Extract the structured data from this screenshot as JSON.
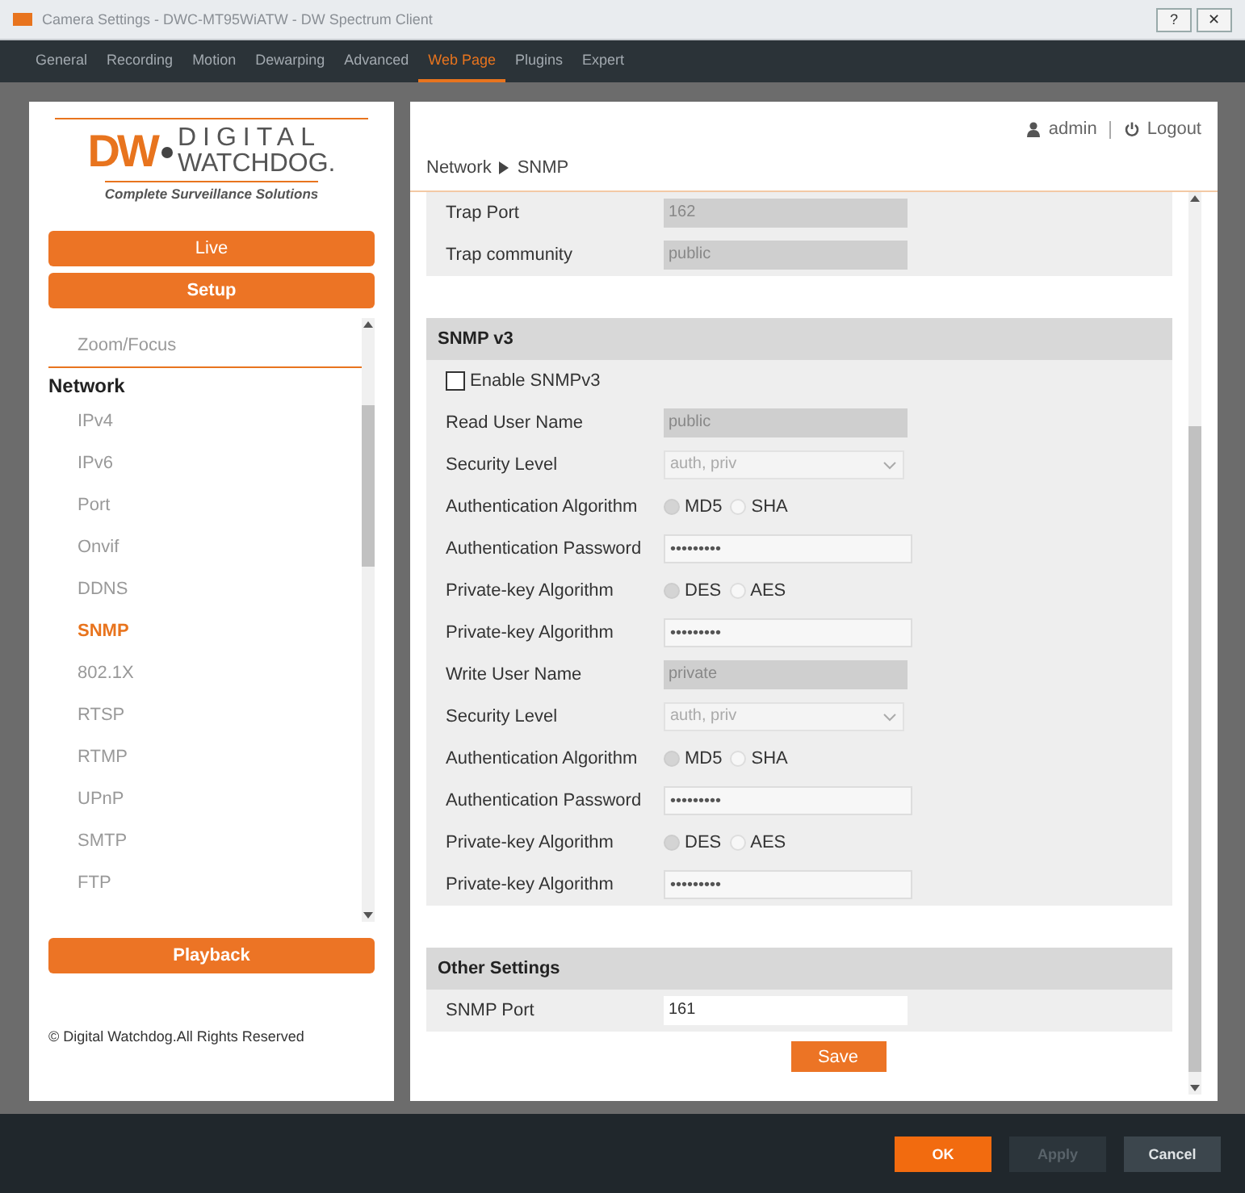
{
  "title_bar": {
    "title": "Camera Settings - DWC-MT95WiATW - DW Spectrum Client",
    "buttons": [
      "?",
      "✕"
    ]
  },
  "tabs": [
    {
      "label": "General",
      "selected": false
    },
    {
      "label": "Recording",
      "selected": false
    },
    {
      "label": "Motion",
      "selected": false
    },
    {
      "label": "Dewarping",
      "selected": false
    },
    {
      "label": "Advanced",
      "selected": false
    },
    {
      "label": "Web Page",
      "selected": true
    },
    {
      "label": "Plugins",
      "selected": false
    },
    {
      "label": "Expert",
      "selected": false
    }
  ],
  "sidebar": {
    "logo": {
      "mark": "DW",
      "name_top": "DIGITAL",
      "name_bottom": "WATCHDOG.",
      "tagline": "Complete Surveillance Solutions"
    },
    "buttons": [
      "Live",
      "Setup"
    ],
    "menu": [
      {
        "kind": "item",
        "label": "Zoom/Focus",
        "selected": false
      },
      {
        "kind": "heading",
        "label": "Network"
      },
      {
        "kind": "item",
        "label": "IPv4",
        "selected": false
      },
      {
        "kind": "item",
        "label": "IPv6",
        "selected": false
      },
      {
        "kind": "item",
        "label": "Port",
        "selected": false
      },
      {
        "kind": "item",
        "label": "Onvif",
        "selected": false
      },
      {
        "kind": "item",
        "label": "DDNS",
        "selected": false
      },
      {
        "kind": "item",
        "label": "SNMP",
        "selected": true
      },
      {
        "kind": "item",
        "label": "802.1X",
        "selected": false
      },
      {
        "kind": "item",
        "label": "RTSP",
        "selected": false
      },
      {
        "kind": "item",
        "label": "RTMP",
        "selected": false
      },
      {
        "kind": "item",
        "label": "UPnP",
        "selected": false
      },
      {
        "kind": "item",
        "label": "SMTP",
        "selected": false
      },
      {
        "kind": "item",
        "label": "FTP",
        "selected": false
      }
    ],
    "playback": "Playback",
    "copyright": "© Digital Watchdog.All Rights Reserved"
  },
  "content": {
    "user": "admin",
    "logout": "Logout",
    "breadcrumb": [
      "Network",
      "SNMP"
    ],
    "sections": [
      {
        "rows": [
          {
            "kind": "readonly",
            "label": "Trap Port",
            "value": "162"
          },
          {
            "kind": "readonly",
            "label": "Trap community",
            "value": "public"
          }
        ]
      },
      {
        "title": "SNMP v3",
        "rows": [
          {
            "kind": "checkbox",
            "label": "Enable SNMPv3",
            "checked": false
          },
          {
            "kind": "readonly",
            "label": "Read User Name",
            "value": "public"
          },
          {
            "kind": "select",
            "label": "Security Level",
            "value": "auth, priv"
          },
          {
            "kind": "radio",
            "label": "Authentication Algorithm",
            "options": [
              {
                "label": "MD5",
                "selected": true
              },
              {
                "label": "SHA",
                "selected": false
              }
            ]
          },
          {
            "kind": "password",
            "label": "Authentication Password",
            "value": "•••••••••"
          },
          {
            "kind": "radio",
            "label": "Private-key Algorithm",
            "options": [
              {
                "label": "DES",
                "selected": true
              },
              {
                "label": "AES",
                "selected": false
              }
            ]
          },
          {
            "kind": "password",
            "label": "Private-key Algorithm",
            "value": "•••••••••"
          },
          {
            "kind": "readonly",
            "label": "Write User Name",
            "value": "private"
          },
          {
            "kind": "select",
            "label": "Security Level",
            "value": "auth, priv"
          },
          {
            "kind": "radio",
            "label": "Authentication Algorithm",
            "options": [
              {
                "label": "MD5",
                "selected": true
              },
              {
                "label": "SHA",
                "selected": false
              }
            ]
          },
          {
            "kind": "password",
            "label": "Authentication Password",
            "value": "•••••••••"
          },
          {
            "kind": "radio",
            "label": "Private-key Algorithm",
            "options": [
              {
                "label": "DES",
                "selected": true
              },
              {
                "label": "AES",
                "selected": false
              }
            ]
          },
          {
            "kind": "password",
            "label": "Private-key Algorithm",
            "value": "•••••••••"
          }
        ]
      },
      {
        "title": "Other Settings",
        "rows": [
          {
            "kind": "text",
            "label": "SNMP Port",
            "value": "161"
          }
        ]
      }
    ],
    "save": "Save"
  },
  "footer": [
    {
      "label": "OK",
      "kind": "primary",
      "disabled": false
    },
    {
      "label": "Apply",
      "kind": "secondary",
      "disabled": true
    },
    {
      "label": "Cancel",
      "kind": "secondary",
      "disabled": false
    }
  ]
}
